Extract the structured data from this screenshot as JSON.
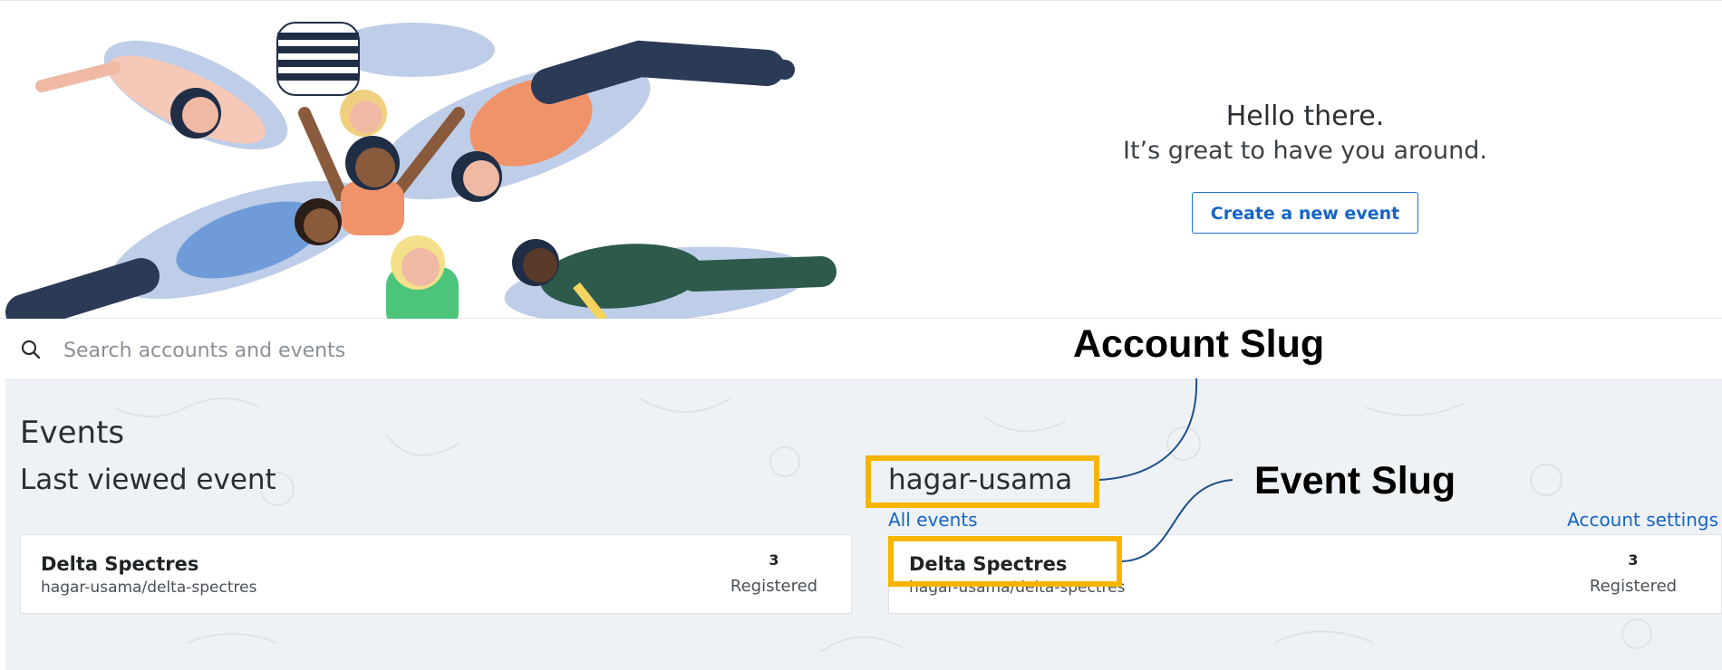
{
  "hero": {
    "title": "Hello there.",
    "subtitle": "It’s great to have you around.",
    "create_button": "Create a new event"
  },
  "search": {
    "placeholder": "Search accounts and events",
    "icon": "search-icon"
  },
  "events": {
    "heading": "Events",
    "last_viewed_heading": "Last viewed event",
    "last_viewed_card": {
      "name": "Delta Spectres",
      "slug": "hagar-usama/delta-spectres",
      "count": "3",
      "count_label": "Registered"
    },
    "account": {
      "name": "hagar-usama",
      "all_events_link": "All events",
      "settings_link": "Account settings",
      "cards": [
        {
          "name": "Delta Spectres",
          "slug": "hagar-usama/delta-spectres",
          "count": "3",
          "count_label": "Registered"
        }
      ]
    }
  },
  "annotations": {
    "account_slug_label": "Account Slug",
    "event_slug_label": "Event Slug",
    "highlight_color": "#f7b500"
  },
  "colors": {
    "link": "#1665c6",
    "background": "#eef2f5"
  }
}
